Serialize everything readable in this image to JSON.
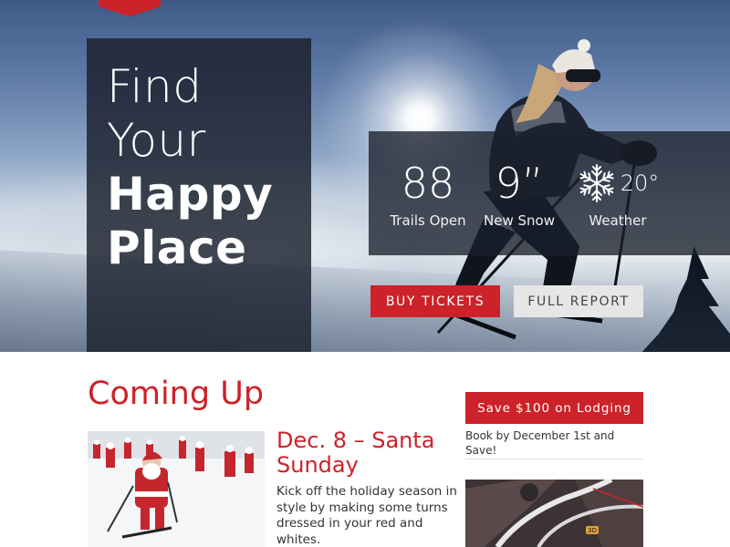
{
  "hero": {
    "headline_line1": "Find",
    "headline_line2": "Your",
    "headline_line3": "Happy",
    "headline_line4": "Place",
    "stats": [
      {
        "value": "88",
        "label": "Trails Open"
      },
      {
        "value": "9”",
        "label": "New Snow"
      },
      {
        "value": "20°",
        "label": "Weather",
        "icon": "snowflake-icon"
      }
    ],
    "buttons": {
      "buy_tickets": "BUY TICKETS",
      "full_report": "FULL REPORT"
    }
  },
  "content": {
    "section_title": "Coming Up",
    "event": {
      "date_title": "Dec. 8 – Santa Sunday",
      "description": "Kick off the holiday season in style by making some turns dressed in your red and whites."
    },
    "sidebar": {
      "promo_label": "Save $100 on Lodging",
      "promo_note": "Book by December 1st and Save!",
      "map_badge": "3D"
    }
  },
  "colors": {
    "brand_red": "#cc2229",
    "dark_overlay": "#1a202c",
    "light_button": "#e6e6e6"
  }
}
